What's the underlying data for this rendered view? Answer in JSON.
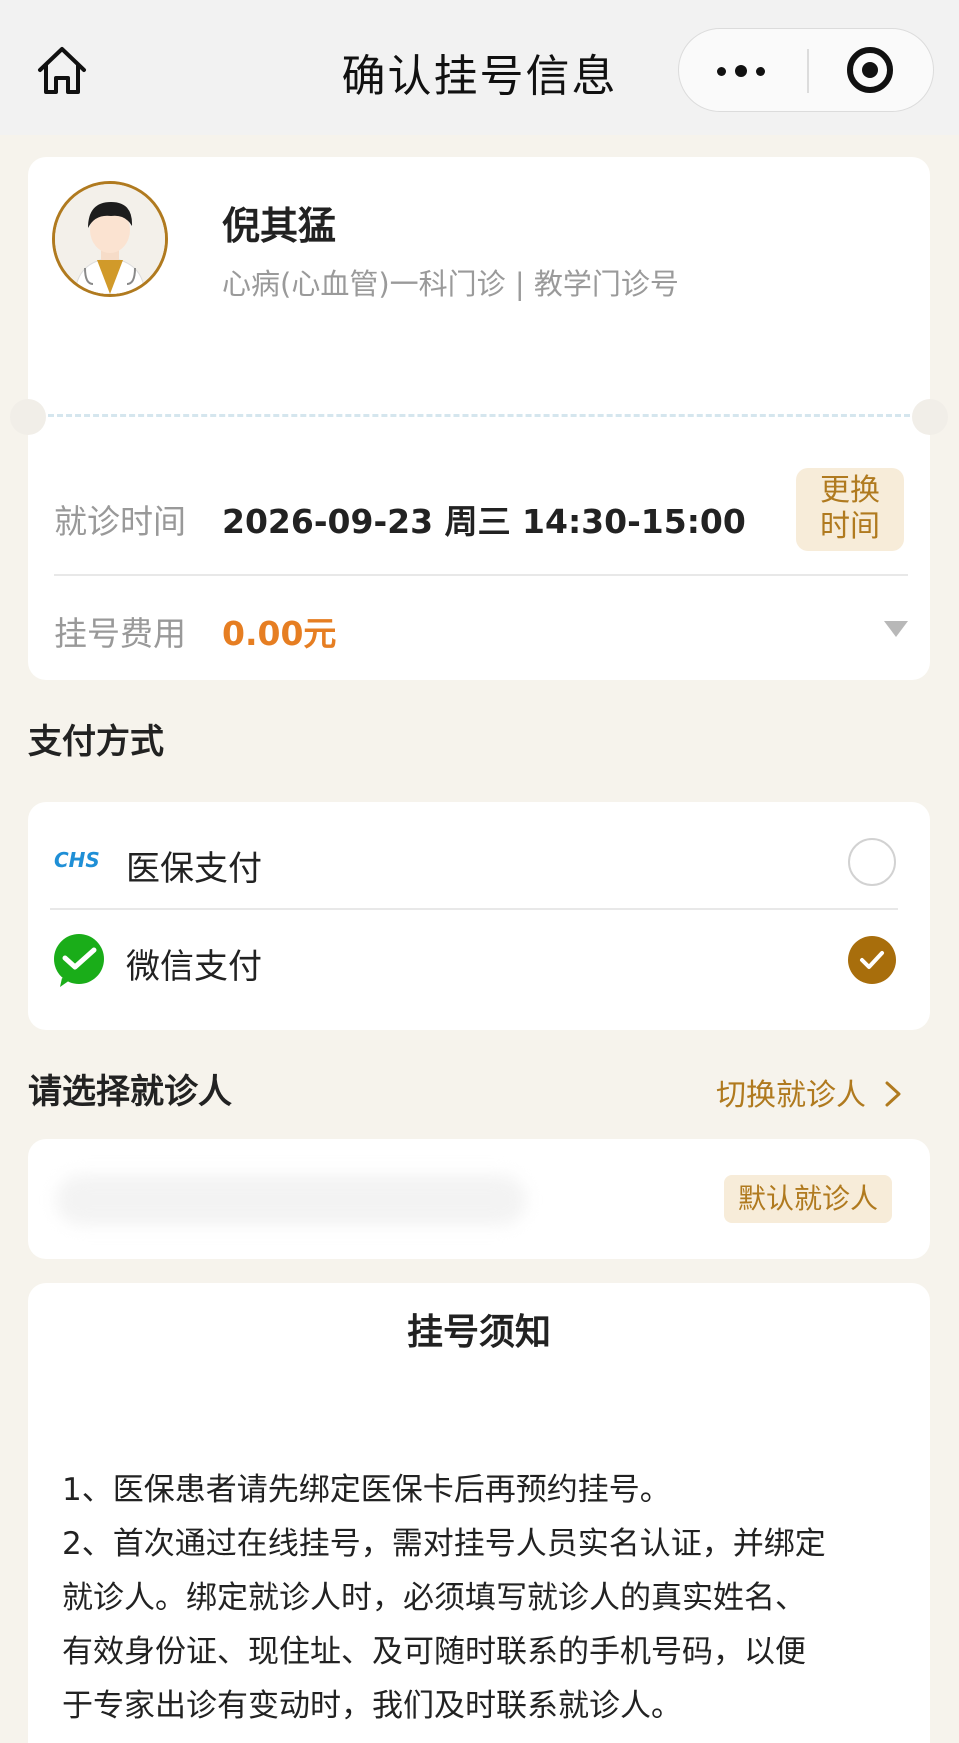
{
  "nav": {
    "title": "确认挂号信息"
  },
  "doctor": {
    "name": "倪其猛",
    "department": "心病(心血管)一科门诊 | 教学门诊号"
  },
  "visit": {
    "time_label": "就诊时间",
    "time_value": "2026-09-23 周三 14:30-15:00",
    "change_line1": "更换",
    "change_line2": "时间",
    "fee_label": "挂号费用",
    "fee_value": "0.00元"
  },
  "payment": {
    "section_title": "支付方式",
    "options": [
      {
        "logo_text": "CHS",
        "label": "医保支付",
        "selected": false
      },
      {
        "label": "微信支付",
        "selected": true
      }
    ]
  },
  "patient": {
    "section_title": "请选择就诊人",
    "switch_label": "切换就诊人",
    "default_badge": "默认就诊人"
  },
  "notice": {
    "title": "挂号须知",
    "lines": [
      "1、医保患者请先绑定医保卡后再预约挂号。",
      "2、首次通过在线挂号，需对挂号人员实名认证，并绑定",
      "就诊人。绑定就诊人时，必须填写就诊人的真实姓名、",
      "有效身份证、现住址、及可随时联系的手机号码，以便",
      "于专家出诊有变动时，我们及时联系就诊人。"
    ]
  },
  "colors": {
    "accent": "#b07a1f",
    "fee": "#e67e22",
    "wechat_green": "#1aad19",
    "chs_blue": "#1f8fd6"
  }
}
